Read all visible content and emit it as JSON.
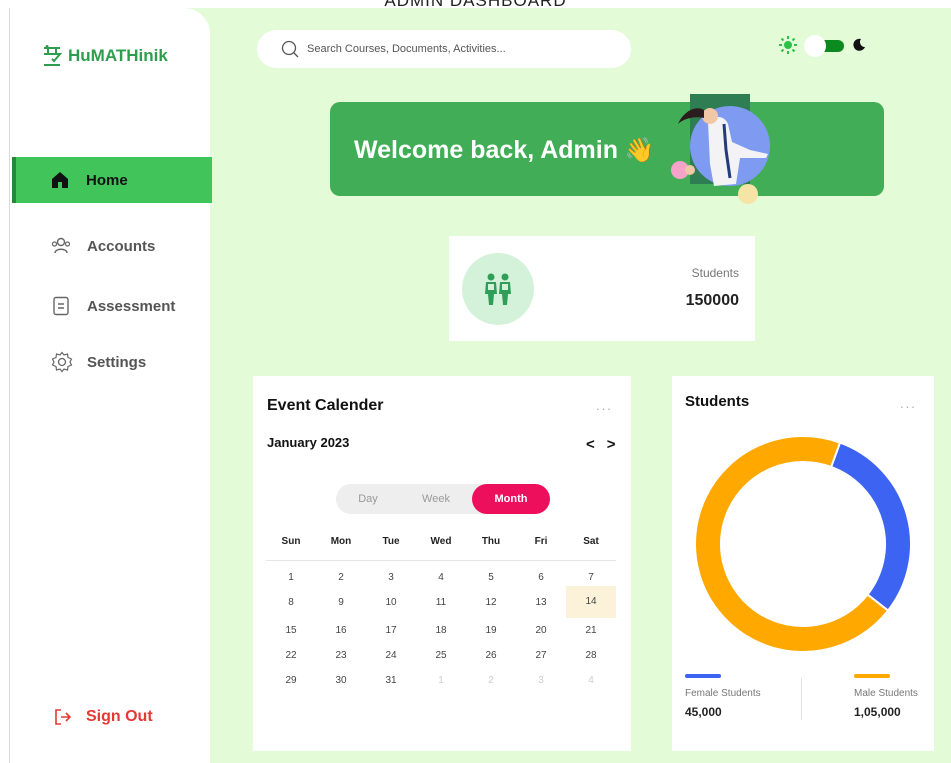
{
  "page": {
    "title": "ADMIN DASHBOARD"
  },
  "brand": {
    "name": "HuMATHinik",
    "color": "#2e9e4e"
  },
  "sidebar": {
    "items": [
      {
        "label": "Home",
        "icon": "home-icon",
        "active": true
      },
      {
        "label": "Accounts",
        "icon": "users-icon",
        "active": false
      },
      {
        "label": "Assessment",
        "icon": "document-icon",
        "active": false
      },
      {
        "label": "Settings",
        "icon": "gear-icon",
        "active": false
      }
    ],
    "signout": {
      "label": "Sign Out",
      "icon": "sign-out-icon"
    }
  },
  "search": {
    "placeholder": "Search Courses, Documents, Activities..."
  },
  "theme": {
    "sun_icon": "sun-icon",
    "moon_icon": "moon-icon",
    "mode": "dark"
  },
  "banner": {
    "text": "Welcome back, Admin",
    "emoji": "👋"
  },
  "stat": {
    "label": "Students",
    "value": "150000",
    "icon": "students-icon"
  },
  "calendar": {
    "title": "Event Calender",
    "month": "January 2023",
    "prev": "<",
    "next": ">",
    "views": [
      "Day",
      "Week",
      "Month"
    ],
    "active_view": "Month",
    "weekdays": [
      "Sun",
      "Mon",
      "Tue",
      "Wed",
      "Thu",
      "Fri",
      "Sat"
    ],
    "weeks": [
      [
        "1",
        "2",
        "3",
        "4",
        "5",
        "6",
        "7"
      ],
      [
        "8",
        "9",
        "10",
        "11",
        "12",
        "13",
        "14"
      ],
      [
        "15",
        "16",
        "17",
        "18",
        "19",
        "20",
        "21"
      ],
      [
        "22",
        "23",
        "24",
        "25",
        "26",
        "27",
        "28"
      ],
      [
        "29",
        "30",
        "31",
        "1",
        "2",
        "3",
        "4"
      ]
    ],
    "highlighted": "14",
    "more": "..."
  },
  "students_chart": {
    "title": "Students",
    "more": "...",
    "legend": [
      {
        "name": "Female Students",
        "value": "45,000",
        "color": "#3d63f2"
      },
      {
        "name": "Male Students",
        "value": "1,05,000",
        "color": "#ffa800"
      }
    ]
  },
  "chart_data": {
    "type": "pie",
    "title": "Students",
    "categories": [
      "Female Students",
      "Male Students"
    ],
    "values": [
      45000,
      105000
    ],
    "colors": [
      "#3d63f2",
      "#ffa800"
    ],
    "donut": true
  }
}
